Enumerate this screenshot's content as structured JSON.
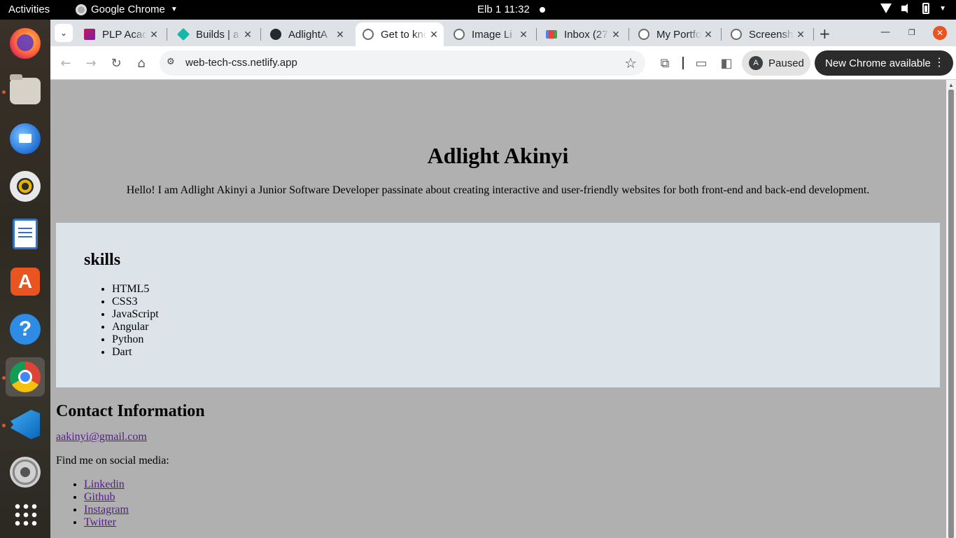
{
  "system": {
    "activities": "Activities",
    "app_name": "Google Chrome",
    "clock": "Elb 1  11:32"
  },
  "dock": {
    "items": [
      "Firefox",
      "Files",
      "Thunderbird",
      "Rhythmbox",
      "LibreOffice Writer",
      "Ubuntu Software",
      "Help",
      "Google Chrome",
      "Visual Studio Code",
      "Settings",
      "Show Applications"
    ]
  },
  "browser": {
    "tabs": [
      {
        "label": "PLP Academy",
        "icon": "plp-icon"
      },
      {
        "label": "Builds | a",
        "icon": "builds-icon"
      },
      {
        "label": "AdlightA",
        "icon": "github-icon"
      },
      {
        "label": "Get to know",
        "icon": "globe-icon",
        "active": true
      },
      {
        "label": "Image Li",
        "icon": "globe-icon"
      },
      {
        "label": "Inbox (27",
        "icon": "gmail-icon"
      },
      {
        "label": "My Portfo",
        "icon": "globe-icon"
      },
      {
        "label": "Screensh",
        "icon": "globe-icon"
      }
    ],
    "url": "web-tech-css.netlify.app",
    "profile_initial": "A",
    "profile_status": "Paused",
    "update_label": "New Chrome available"
  },
  "page": {
    "header": {
      "name": "Adlight Akinyi",
      "intro": "Hello! I am Adlight Akinyi a Junior Software Developer passinate about creating interactive and user-friendly websites for both front-end and back-end development."
    },
    "skills": {
      "title": "skills",
      "items": [
        "HTML5",
        "CSS3",
        "JavaScript",
        "Angular",
        "Python",
        "Dart"
      ]
    },
    "contact": {
      "title": "Contact Information",
      "email": "aakinyi@gmail.com",
      "social_intro": "Find me on social media:",
      "links": [
        "Linkedin",
        "Github",
        "Instagram",
        "Twitter"
      ]
    }
  },
  "colors": {
    "page_bg": "#b0b0b0",
    "skills_bg": "#dce3e9",
    "link": "#551a8b",
    "ubuntu_orange": "#e95420"
  }
}
